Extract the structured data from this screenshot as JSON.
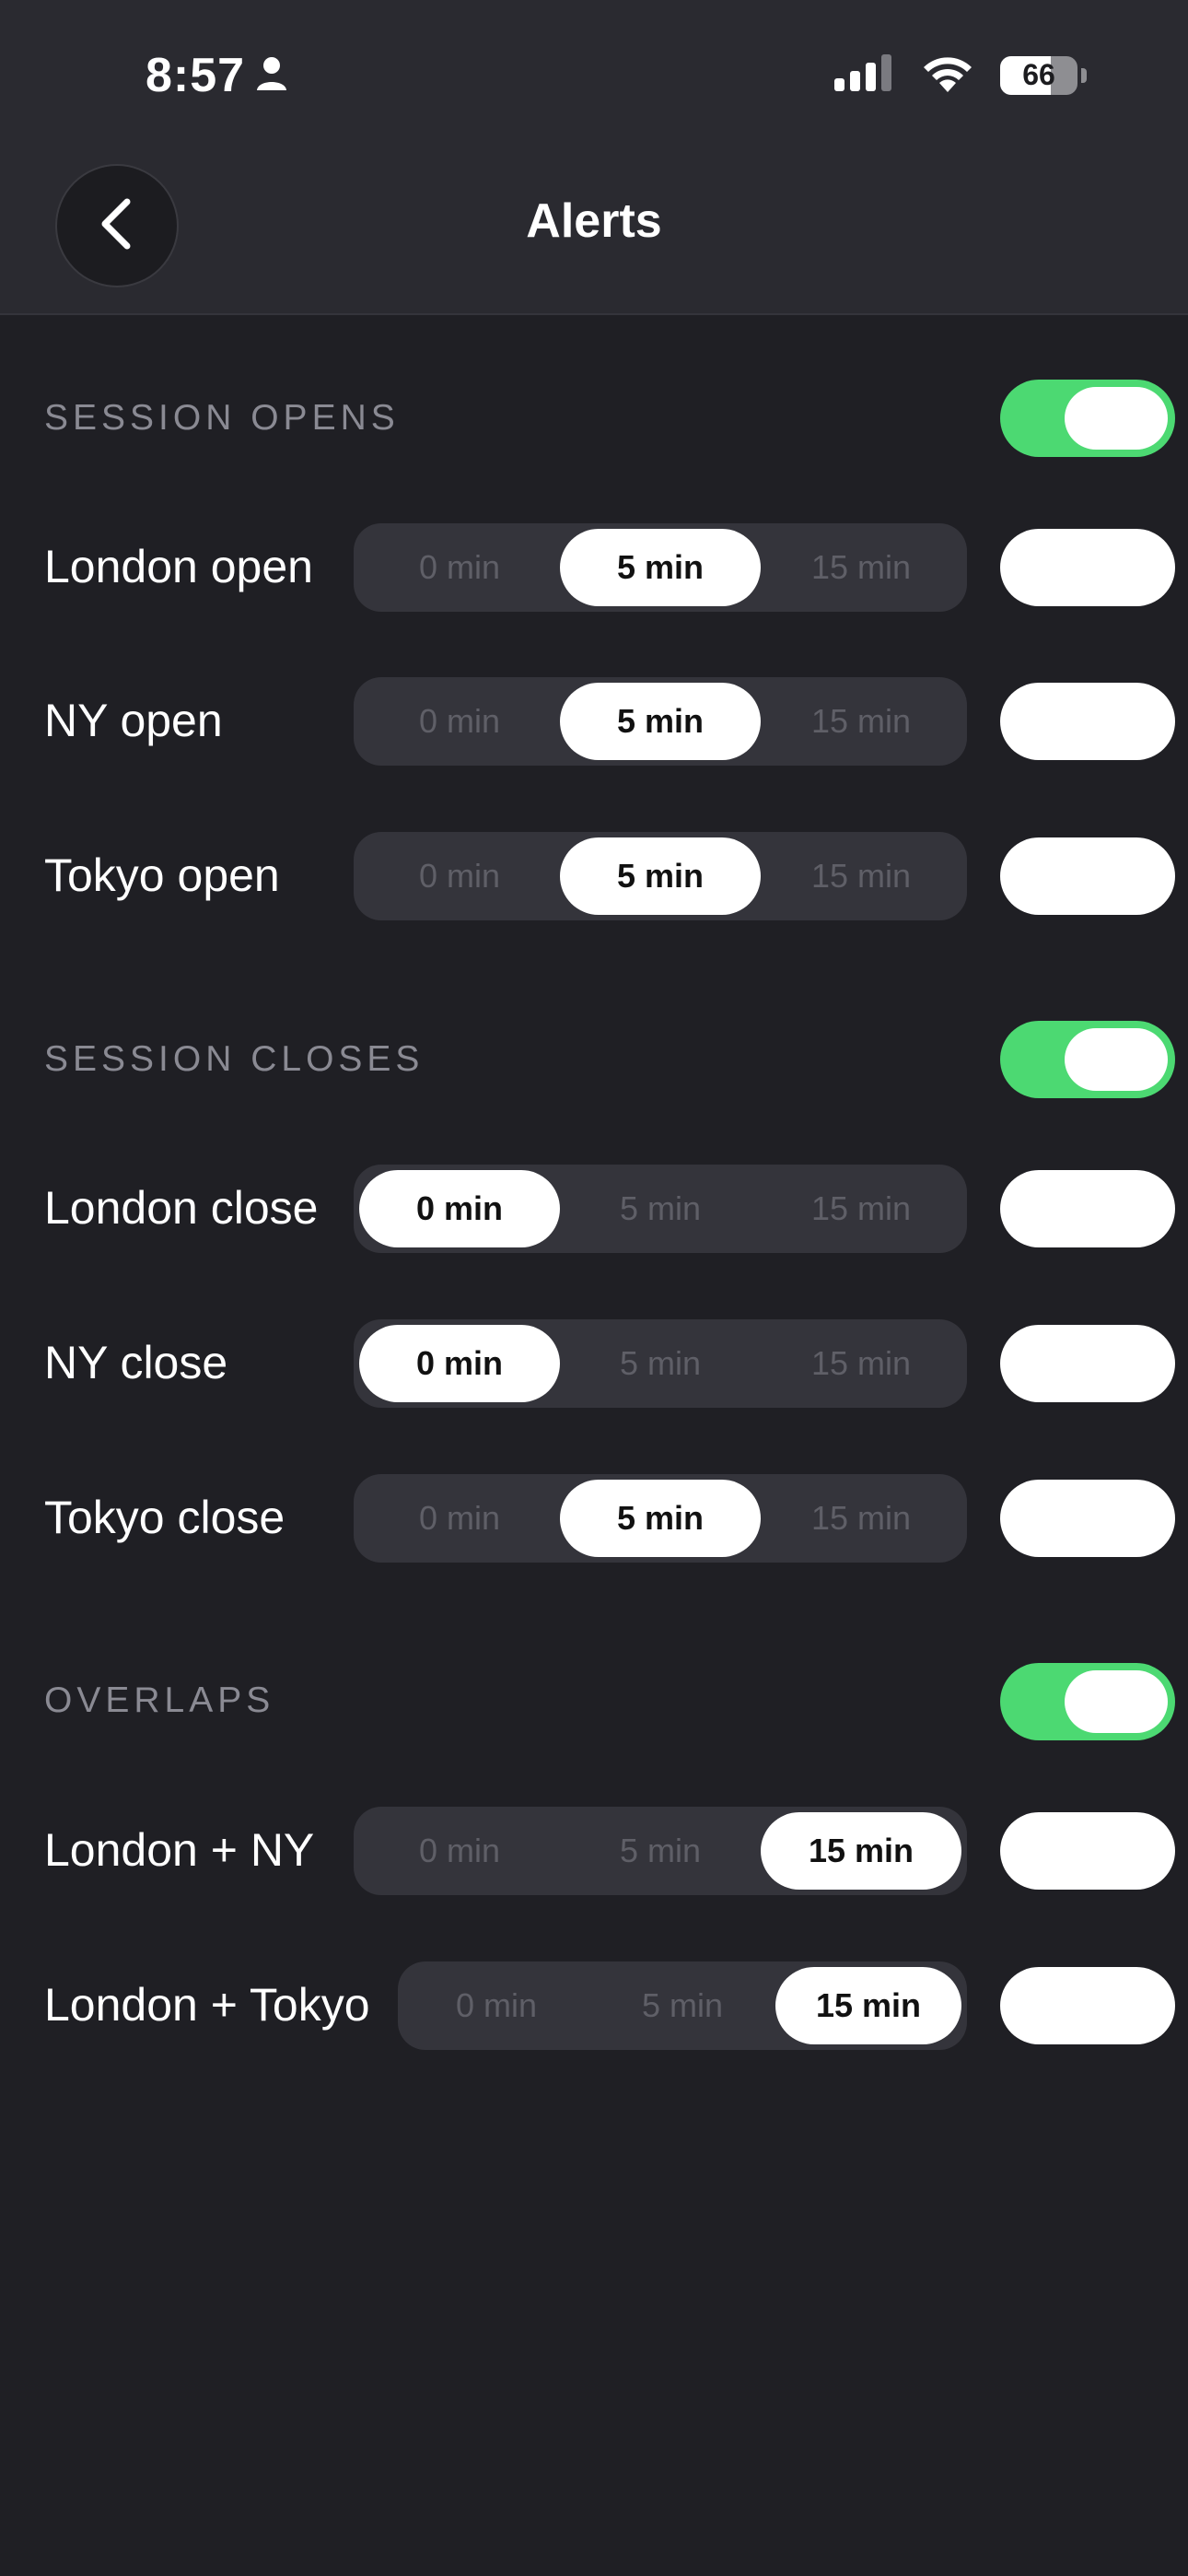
{
  "status_bar": {
    "time": "8:57",
    "battery": "66",
    "battery_level": 0.66
  },
  "nav": {
    "title": "Alerts"
  },
  "sections": [
    {
      "header": "SESSION OPENS",
      "enabled": true,
      "rows": [
        {
          "label": "London open",
          "options": [
            "0 min",
            "5 min",
            "15 min"
          ],
          "selected": 1,
          "enabled": false
        },
        {
          "label": "NY open",
          "options": [
            "0 min",
            "5 min",
            "15 min"
          ],
          "selected": 1,
          "enabled": false
        },
        {
          "label": "Tokyo open",
          "options": [
            "0 min",
            "5 min",
            "15 min"
          ],
          "selected": 1,
          "enabled": false
        }
      ]
    },
    {
      "header": "SESSION CLOSES",
      "enabled": true,
      "rows": [
        {
          "label": "London close",
          "options": [
            "0 min",
            "5 min",
            "15 min"
          ],
          "selected": 0,
          "enabled": false
        },
        {
          "label": "NY close",
          "options": [
            "0 min",
            "5 min",
            "15 min"
          ],
          "selected": 0,
          "enabled": false
        },
        {
          "label": "Tokyo close",
          "options": [
            "0 min",
            "5 min",
            "15 min"
          ],
          "selected": 1,
          "enabled": false
        }
      ]
    },
    {
      "header": "OVERLAPS",
      "enabled": true,
      "rows": [
        {
          "label": "London + NY",
          "options": [
            "0 min",
            "5 min",
            "15 min"
          ],
          "selected": 2,
          "enabled": false
        },
        {
          "label": "London + Tokyo",
          "options": [
            "0 min",
            "5 min",
            "15 min"
          ],
          "selected": 2,
          "enabled": false
        }
      ]
    }
  ],
  "colors": {
    "background": "#1f1f24",
    "toggle_on": "#4cd972",
    "segment_bg": "#34343b"
  }
}
